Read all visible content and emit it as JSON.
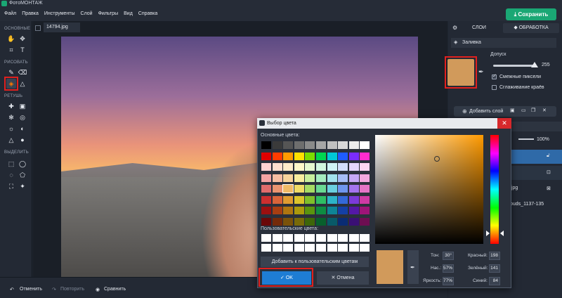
{
  "app": {
    "title": "ФотоМОНТАЖ"
  },
  "menu": {
    "items": [
      "Файл",
      "Правка",
      "Инструменты",
      "Слой",
      "Фильтры",
      "Вид",
      "Справка"
    ]
  },
  "save_label": "Сохранить",
  "tab_filename": "14794.jpg",
  "toolbox": {
    "sections": [
      "ОСНОВНЫЕ",
      "РИСОВАТЬ",
      "РЕТУШЬ",
      "ВЫДЕЛИТЬ"
    ]
  },
  "bottom": {
    "undo": "Отменить",
    "redo": "Повторить",
    "compare": "Сравнить"
  },
  "right_panel": {
    "tabs": [
      "СЛОИ",
      "ОБРАБОТКА"
    ],
    "fill_label": "Заливка",
    "tolerance_label": "Допуск",
    "tolerance_value": "255",
    "adjacent_pixels": "Смежные пиксели",
    "smoothing": "Сглаживание краёв",
    "add_layer": "Добавить слой",
    "opacity": "100%",
    "layer_names": [
      ".jpg",
      "ouds_1137-135"
    ],
    "accent": "#D19A5B"
  },
  "dialog": {
    "title": "Выбор цвета",
    "basic_colors_label": "Основные цвета:",
    "custom_colors_label": "Пользовательские цвета:",
    "add_custom": "Добавить к пользовательским цветам",
    "ok": "OK",
    "cancel": "Отмена",
    "hue_label": "Тон:",
    "hue": "30°",
    "sat_label": "Нас.:",
    "sat": "57%",
    "val_label": "Яркость:",
    "val": "77%",
    "red_label": "Красный:",
    "red": "198",
    "green_label": "Зелёный:",
    "green": "141",
    "blue_label": "Синий:",
    "blue": "84",
    "basic_colors": [
      [
        "#000000",
        "#3a3a3a",
        "#555555",
        "#6e6e6e",
        "#8a8a8a",
        "#a6a6a6",
        "#c0c0c0",
        "#d8d8d8",
        "#ececec",
        "#ffffff"
      ],
      [
        "#e00000",
        "#ff3c00",
        "#ff9a00",
        "#ffe000",
        "#7bdc00",
        "#00d650",
        "#00c8d6",
        "#1e5cff",
        "#7a2cff",
        "#ff2cd0"
      ],
      [
        "#ffd2d2",
        "#ffe0cf",
        "#ffecc9",
        "#fff8c9",
        "#e6f9cf",
        "#d2f7df",
        "#d0f3f7",
        "#d2defc",
        "#e4d6fc",
        "#fcd6f2"
      ],
      [
        "#f4a3a3",
        "#f6bda2",
        "#f7d39b",
        "#f7ec9e",
        "#c8ee9c",
        "#a5ebbe",
        "#a2e2ec",
        "#a6bdf6",
        "#c6a8f6",
        "#f3a8df"
      ],
      [
        "#e06c6c",
        "#ea9470",
        "#f0ba66",
        "#efdc66",
        "#a6dc64",
        "#6ad993",
        "#6acfdf",
        "#6f96ee",
        "#a474ee",
        "#e574c6"
      ],
      [
        "#cc2f2f",
        "#d9643a",
        "#e09c31",
        "#dcc52c",
        "#7fbf2a",
        "#2fbd64",
        "#2db3c8",
        "#3469d9",
        "#7b3ad9",
        "#cf3aa4"
      ],
      [
        "#9c1010",
        "#a83e12",
        "#b07610",
        "#ac9a0c",
        "#5a940e",
        "#0e8c42",
        "#0e8496",
        "#1440a6",
        "#5418a6",
        "#9e1478"
      ],
      [
        "#6a0808",
        "#742a0a",
        "#7a520a",
        "#786a08",
        "#3e6608",
        "#08602c",
        "#085a68",
        "#0a2c74",
        "#3a1074",
        "#6e0e52"
      ]
    ]
  }
}
